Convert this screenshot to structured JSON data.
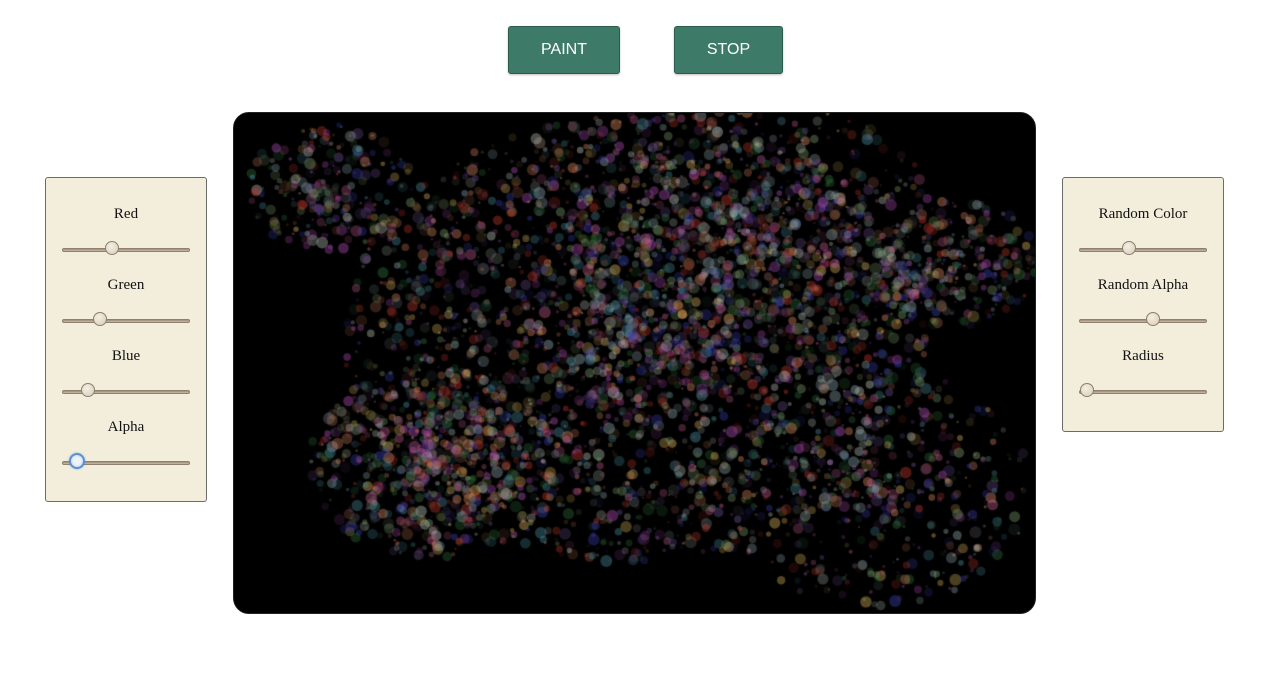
{
  "toolbar": {
    "paint_label": "PAINT",
    "stop_label": "STOP",
    "accent_color": "#3d7a68"
  },
  "left_panel": {
    "sliders": [
      {
        "label": "Red",
        "value": 0.39
      },
      {
        "label": "Green",
        "value": 0.3
      },
      {
        "label": "Blue",
        "value": 0.2
      },
      {
        "label": "Alpha",
        "value": 0.12,
        "focused": true
      }
    ]
  },
  "right_panel": {
    "sliders": [
      {
        "label": "Random Color",
        "value": 0.39
      },
      {
        "label": "Random Alpha",
        "value": 0.58
      },
      {
        "label": "Radius",
        "value": 0.06
      }
    ]
  },
  "canvas": {
    "background": "#000000",
    "palette": [
      "#c0392b",
      "#8fa8b0",
      "#d9865e",
      "#b8c0b5",
      "#6b4f8f",
      "#7a9a6a",
      "#c35c8f",
      "#3b3fb0",
      "#b04db8",
      "#d8b35a",
      "#2f6f3a",
      "#4a8fa0"
    ]
  }
}
